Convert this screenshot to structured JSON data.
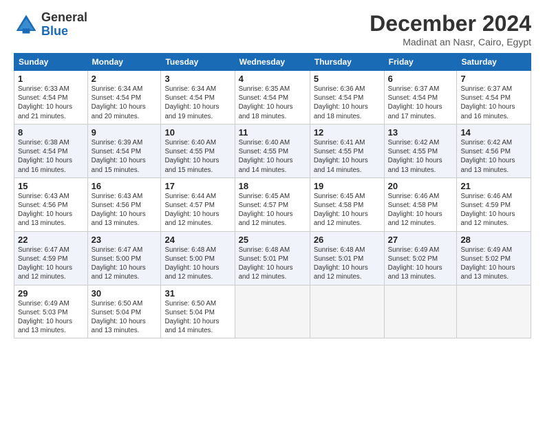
{
  "header": {
    "logo_general": "General",
    "logo_blue": "Blue",
    "month_title": "December 2024",
    "location": "Madinat an Nasr, Cairo, Egypt"
  },
  "days_of_week": [
    "Sunday",
    "Monday",
    "Tuesday",
    "Wednesday",
    "Thursday",
    "Friday",
    "Saturday"
  ],
  "weeks": [
    [
      {
        "day": "1",
        "info": "Sunrise: 6:33 AM\nSunset: 4:54 PM\nDaylight: 10 hours\nand 21 minutes."
      },
      {
        "day": "2",
        "info": "Sunrise: 6:34 AM\nSunset: 4:54 PM\nDaylight: 10 hours\nand 20 minutes."
      },
      {
        "day": "3",
        "info": "Sunrise: 6:34 AM\nSunset: 4:54 PM\nDaylight: 10 hours\nand 19 minutes."
      },
      {
        "day": "4",
        "info": "Sunrise: 6:35 AM\nSunset: 4:54 PM\nDaylight: 10 hours\nand 18 minutes."
      },
      {
        "day": "5",
        "info": "Sunrise: 6:36 AM\nSunset: 4:54 PM\nDaylight: 10 hours\nand 18 minutes."
      },
      {
        "day": "6",
        "info": "Sunrise: 6:37 AM\nSunset: 4:54 PM\nDaylight: 10 hours\nand 17 minutes."
      },
      {
        "day": "7",
        "info": "Sunrise: 6:37 AM\nSunset: 4:54 PM\nDaylight: 10 hours\nand 16 minutes."
      }
    ],
    [
      {
        "day": "8",
        "info": "Sunrise: 6:38 AM\nSunset: 4:54 PM\nDaylight: 10 hours\nand 16 minutes."
      },
      {
        "day": "9",
        "info": "Sunrise: 6:39 AM\nSunset: 4:54 PM\nDaylight: 10 hours\nand 15 minutes."
      },
      {
        "day": "10",
        "info": "Sunrise: 6:40 AM\nSunset: 4:55 PM\nDaylight: 10 hours\nand 15 minutes."
      },
      {
        "day": "11",
        "info": "Sunrise: 6:40 AM\nSunset: 4:55 PM\nDaylight: 10 hours\nand 14 minutes."
      },
      {
        "day": "12",
        "info": "Sunrise: 6:41 AM\nSunset: 4:55 PM\nDaylight: 10 hours\nand 14 minutes."
      },
      {
        "day": "13",
        "info": "Sunrise: 6:42 AM\nSunset: 4:55 PM\nDaylight: 10 hours\nand 13 minutes."
      },
      {
        "day": "14",
        "info": "Sunrise: 6:42 AM\nSunset: 4:56 PM\nDaylight: 10 hours\nand 13 minutes."
      }
    ],
    [
      {
        "day": "15",
        "info": "Sunrise: 6:43 AM\nSunset: 4:56 PM\nDaylight: 10 hours\nand 13 minutes."
      },
      {
        "day": "16",
        "info": "Sunrise: 6:43 AM\nSunset: 4:56 PM\nDaylight: 10 hours\nand 13 minutes."
      },
      {
        "day": "17",
        "info": "Sunrise: 6:44 AM\nSunset: 4:57 PM\nDaylight: 10 hours\nand 12 minutes."
      },
      {
        "day": "18",
        "info": "Sunrise: 6:45 AM\nSunset: 4:57 PM\nDaylight: 10 hours\nand 12 minutes."
      },
      {
        "day": "19",
        "info": "Sunrise: 6:45 AM\nSunset: 4:58 PM\nDaylight: 10 hours\nand 12 minutes."
      },
      {
        "day": "20",
        "info": "Sunrise: 6:46 AM\nSunset: 4:58 PM\nDaylight: 10 hours\nand 12 minutes."
      },
      {
        "day": "21",
        "info": "Sunrise: 6:46 AM\nSunset: 4:59 PM\nDaylight: 10 hours\nand 12 minutes."
      }
    ],
    [
      {
        "day": "22",
        "info": "Sunrise: 6:47 AM\nSunset: 4:59 PM\nDaylight: 10 hours\nand 12 minutes."
      },
      {
        "day": "23",
        "info": "Sunrise: 6:47 AM\nSunset: 5:00 PM\nDaylight: 10 hours\nand 12 minutes."
      },
      {
        "day": "24",
        "info": "Sunrise: 6:48 AM\nSunset: 5:00 PM\nDaylight: 10 hours\nand 12 minutes."
      },
      {
        "day": "25",
        "info": "Sunrise: 6:48 AM\nSunset: 5:01 PM\nDaylight: 10 hours\nand 12 minutes."
      },
      {
        "day": "26",
        "info": "Sunrise: 6:48 AM\nSunset: 5:01 PM\nDaylight: 10 hours\nand 12 minutes."
      },
      {
        "day": "27",
        "info": "Sunrise: 6:49 AM\nSunset: 5:02 PM\nDaylight: 10 hours\nand 13 minutes."
      },
      {
        "day": "28",
        "info": "Sunrise: 6:49 AM\nSunset: 5:02 PM\nDaylight: 10 hours\nand 13 minutes."
      }
    ],
    [
      {
        "day": "29",
        "info": "Sunrise: 6:49 AM\nSunset: 5:03 PM\nDaylight: 10 hours\nand 13 minutes."
      },
      {
        "day": "30",
        "info": "Sunrise: 6:50 AM\nSunset: 5:04 PM\nDaylight: 10 hours\nand 13 minutes."
      },
      {
        "day": "31",
        "info": "Sunrise: 6:50 AM\nSunset: 5:04 PM\nDaylight: 10 hours\nand 14 minutes."
      },
      null,
      null,
      null,
      null
    ]
  ]
}
